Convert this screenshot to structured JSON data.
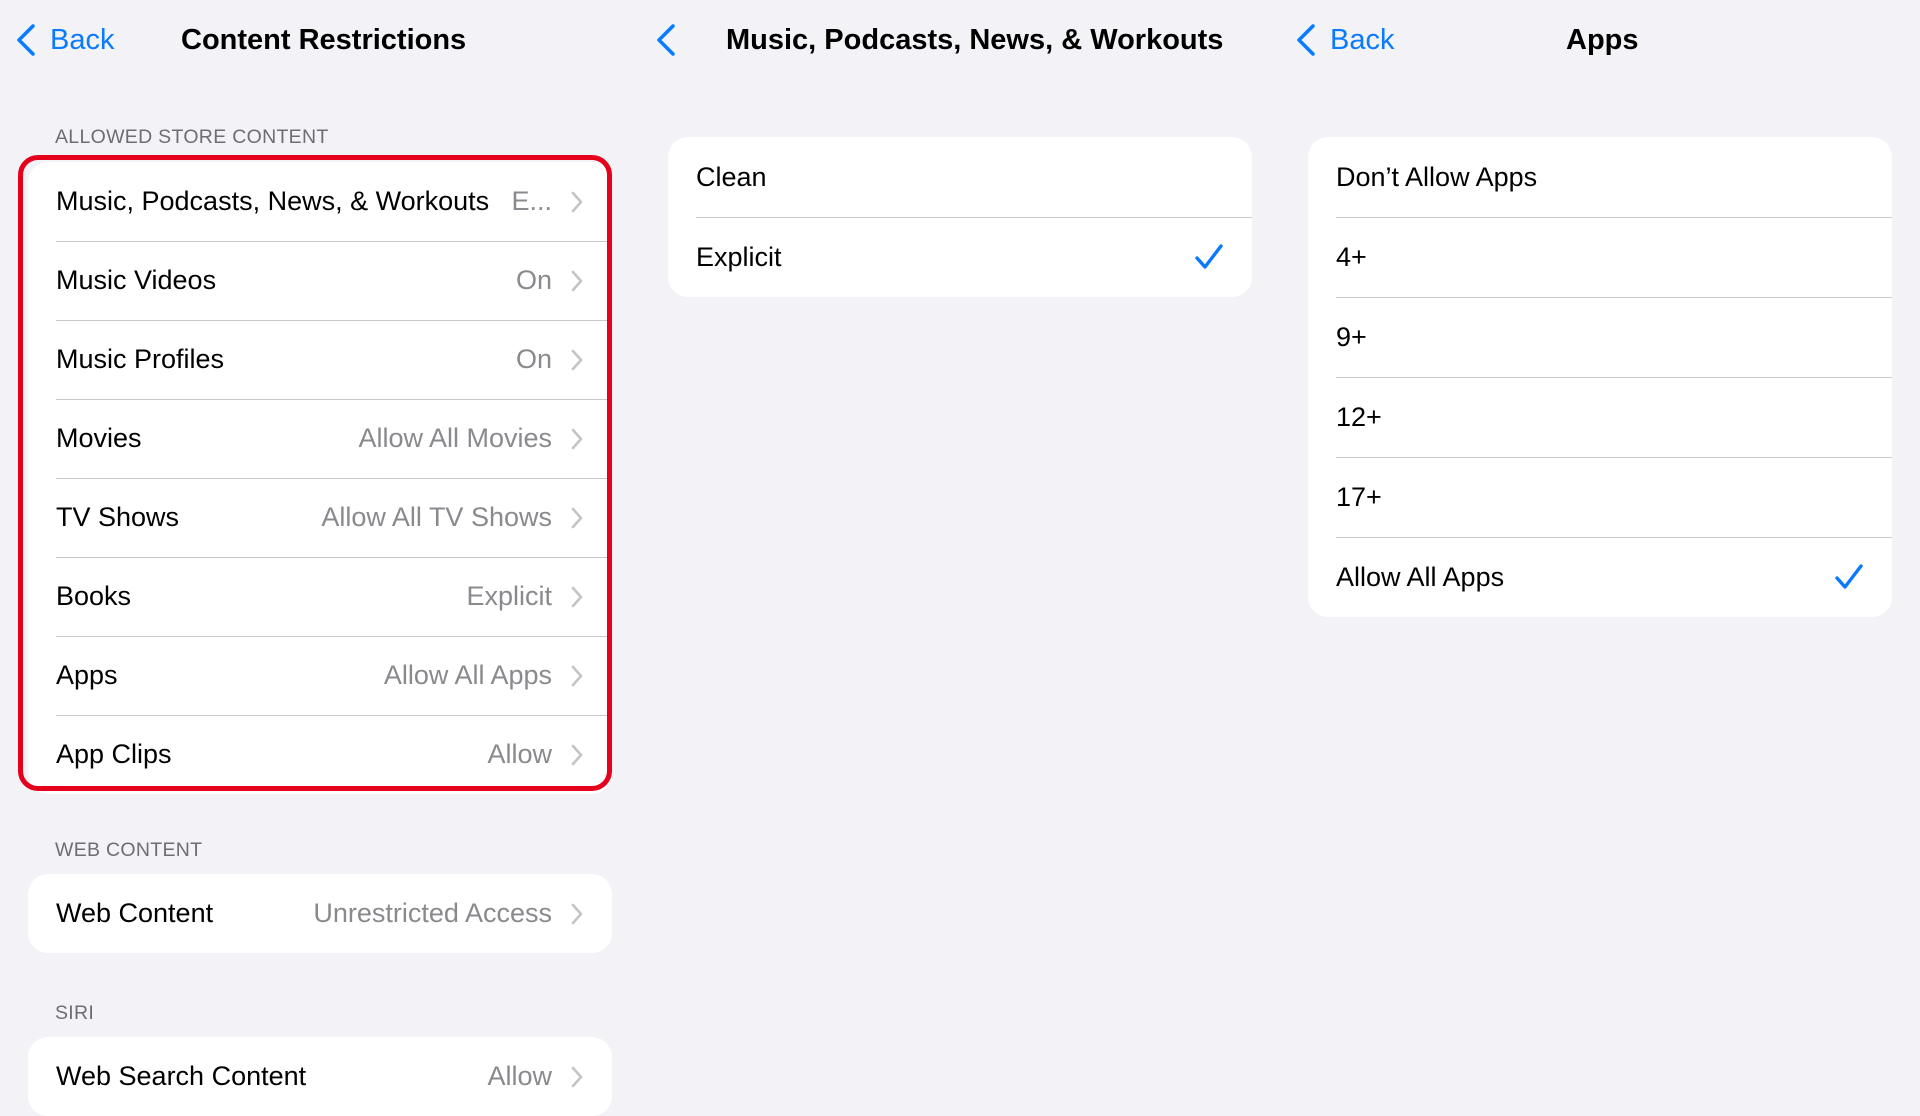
{
  "panel1": {
    "back_label": "Back",
    "title": "Content Restrictions",
    "section_store": "ALLOWED STORE CONTENT",
    "store_rows": [
      {
        "label": "Music, Podcasts, News, & Workouts",
        "value": "E..."
      },
      {
        "label": "Music Videos",
        "value": "On"
      },
      {
        "label": "Music Profiles",
        "value": "On"
      },
      {
        "label": "Movies",
        "value": "Allow All Movies"
      },
      {
        "label": "TV Shows",
        "value": "Allow All TV Shows"
      },
      {
        "label": "Books",
        "value": "Explicit"
      },
      {
        "label": "Apps",
        "value": "Allow All Apps"
      },
      {
        "label": "App Clips",
        "value": "Allow"
      }
    ],
    "section_web": "WEB CONTENT",
    "web_rows": [
      {
        "label": "Web Content",
        "value": "Unrestricted Access"
      }
    ],
    "section_siri": "SIRI",
    "siri_rows": [
      {
        "label": "Web Search Content",
        "value": "Allow"
      }
    ]
  },
  "panel2": {
    "title": "Music, Podcasts, News, & Workouts",
    "options": [
      {
        "label": "Clean",
        "selected": false
      },
      {
        "label": "Explicit",
        "selected": true
      }
    ]
  },
  "panel3": {
    "back_label": "Back",
    "title": "Apps",
    "options": [
      {
        "label": "Don’t Allow Apps",
        "selected": false
      },
      {
        "label": "4+",
        "selected": false
      },
      {
        "label": "9+",
        "selected": false
      },
      {
        "label": "12+",
        "selected": false
      },
      {
        "label": "17+",
        "selected": false
      },
      {
        "label": "Allow All Apps",
        "selected": true
      }
    ]
  },
  "colors": {
    "accent": "#0a7aff",
    "background": "#f2f2f7",
    "highlight": "#e5001c",
    "secondary_text": "#8a8a8e"
  },
  "icons": {
    "back": "chevron-left-icon",
    "disclosure": "chevron-right-icon",
    "selected": "checkmark-icon"
  }
}
